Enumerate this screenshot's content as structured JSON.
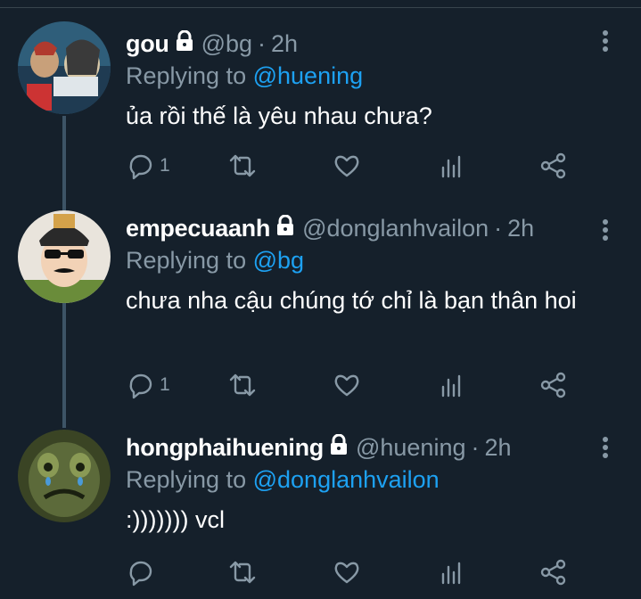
{
  "tweets": [
    {
      "name": "gou",
      "handle": "@bg",
      "time": "2h",
      "reply_prefix": "Replying to",
      "reply_to": "@huening",
      "text": "ủa rồi thế là yêu nhau chưa?",
      "reply_count": "1",
      "avatar_colors": [
        "#2f5e7a",
        "#c8a07a",
        "#e0e6ea"
      ]
    },
    {
      "name": "empecuaanh",
      "handle": "@donglanhvailon",
      "time": "2h",
      "reply_prefix": "Replying to",
      "reply_to": "@bg",
      "text": "chưa nha cậu chúng tớ chỉ là bạn thân hoi",
      "reply_count": "1",
      "avatar_colors": [
        "#e9e4dc",
        "#2a2a2a",
        "#6a8c3a"
      ]
    },
    {
      "name": "hongphaihuening",
      "handle": "@huening",
      "time": "2h",
      "reply_prefix": "Replying to",
      "reply_to": "@donglanhvailon",
      "text": ":))))))) vcl",
      "reply_count": "",
      "avatar_colors": [
        "#5c6a3a",
        "#8a9a55",
        "#3a4424"
      ]
    }
  ],
  "colors": {
    "background": "#15202b",
    "link": "#1da1f2",
    "muted": "#8899a6",
    "thread_line": "#3d5466"
  },
  "icons": [
    "lock-icon",
    "more-icon",
    "reply-icon",
    "retweet-icon",
    "like-icon",
    "analytics-icon",
    "share-icon"
  ]
}
